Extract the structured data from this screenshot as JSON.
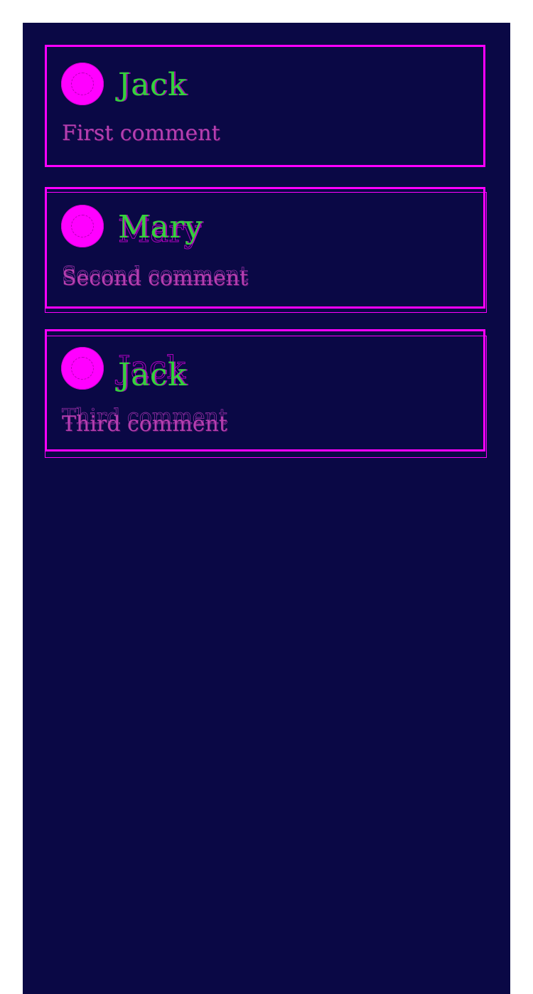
{
  "comments": [
    {
      "author": "Jack",
      "text": "First comment"
    },
    {
      "author": "Mary",
      "text": "Second comment"
    },
    {
      "author": "Jack",
      "text": "Third comment"
    }
  ],
  "colors": {
    "background": "#0a0845",
    "accent": "#ff00ff",
    "author_name": "#34d13c",
    "comment_text": "#b53fb0"
  }
}
